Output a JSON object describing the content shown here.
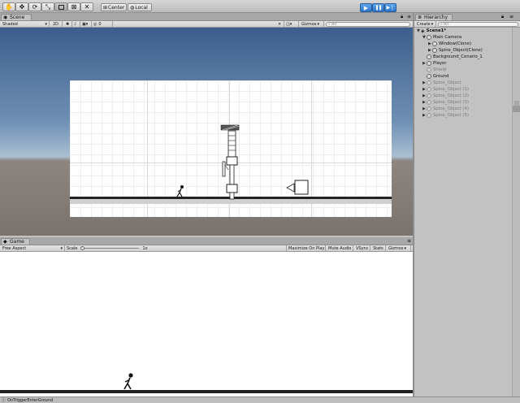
{
  "toolbar": {
    "pivot_label": "Center",
    "space_label": "Local"
  },
  "scene": {
    "tab_label": "Scene",
    "shading_mode": "Shaded",
    "mode_2d": "2D",
    "effects_count": "0",
    "gizmos_label": "Gizmos",
    "search_placeholder": "All"
  },
  "game": {
    "tab_label": "Game",
    "aspect_label": "Free Aspect",
    "scale_label": "Scale",
    "scale_value": "1x",
    "scale_fraction": 0.0,
    "options": [
      "Maximize On Play",
      "Mute Audio",
      "VSync",
      "Stats",
      "Gizmos"
    ]
  },
  "hierarchy": {
    "tab_label": "Hierarchy",
    "create_label": "Create",
    "search_placeholder": "All",
    "items": [
      {
        "label": "Scene1*",
        "depth": 0,
        "arrow": "▼",
        "style": "scene"
      },
      {
        "label": "Main Camera",
        "depth": 1,
        "arrow": "▼",
        "style": "normal"
      },
      {
        "label": "Window(Clone)",
        "depth": 2,
        "arrow": "▶",
        "style": "normal"
      },
      {
        "label": "Spine_Object(Clone)",
        "depth": 2,
        "arrow": "▶",
        "style": "normal"
      },
      {
        "label": "Background_Cenario_1",
        "depth": 1,
        "arrow": "",
        "style": "normal"
      },
      {
        "label": "Player",
        "depth": 1,
        "arrow": "▶",
        "style": "normal"
      },
      {
        "label": "Shield",
        "depth": 1,
        "arrow": "",
        "style": "dim"
      },
      {
        "label": "Ground",
        "depth": 1,
        "arrow": "",
        "style": "normal"
      },
      {
        "label": "Spine_Object",
        "depth": 1,
        "arrow": "▶",
        "style": "dim"
      },
      {
        "label": "Spine_Object (1)",
        "depth": 1,
        "arrow": "▶",
        "style": "dim"
      },
      {
        "label": "Spine_Object (2)",
        "depth": 1,
        "arrow": "▶",
        "style": "dim"
      },
      {
        "label": "Spine_Object (3)",
        "depth": 1,
        "arrow": "▶",
        "style": "dim"
      },
      {
        "label": "Spine_Object (4)",
        "depth": 1,
        "arrow": "▶",
        "style": "dim"
      },
      {
        "label": "Spine_Object (5)",
        "depth": 1,
        "arrow": "▶",
        "style": "dim"
      }
    ]
  },
  "console": {
    "message": "OnTriggerEnterGround"
  },
  "colors": {
    "play_blue": "#2c72c7",
    "panel_gray": "#c2c2c2",
    "sky_top": "#3c5e8c",
    "ground_brown": "#7a736d"
  },
  "icons": [
    "hand-icon",
    "move-icon",
    "rotate-icon",
    "scale-icon",
    "rect-icon",
    "transform-icon",
    "custom-tool-icon",
    "play-icon",
    "pause-icon",
    "step-icon",
    "lock-icon",
    "menu-icon",
    "light-icon",
    "audio-icon",
    "image-icon",
    "wrench-icon",
    "search-icon",
    "player-figure-icon",
    "spine-object-icon",
    "arrow-obstacle-icon",
    "camera-icon"
  ]
}
